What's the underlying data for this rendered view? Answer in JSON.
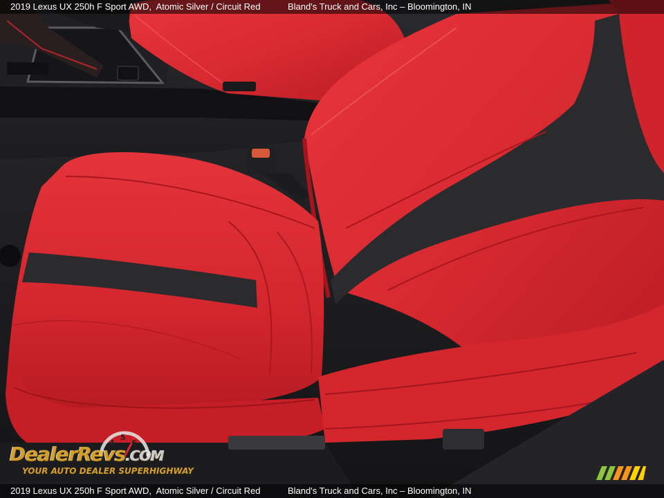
{
  "caption": {
    "title": "2019 Lexus UX 250h F Sport AWD,  Atomic Silver / Circuit Red",
    "dealer": "Bland's Truck and Cars, Inc – Bloomington, IN"
  },
  "watermark": {
    "brand": "DealerRevs",
    "brand_suffix": ".COM",
    "tagline": "YOUR AUTO DEALER SUPERHIGHWAY",
    "gauge_digits": [
      "4",
      "5",
      "6"
    ]
  },
  "colors": {
    "leather_red": "#d8262e",
    "leather_dark_red": "#a5161d",
    "black_insert": "#2b2b2e",
    "brand_gold": "#f2b632"
  }
}
